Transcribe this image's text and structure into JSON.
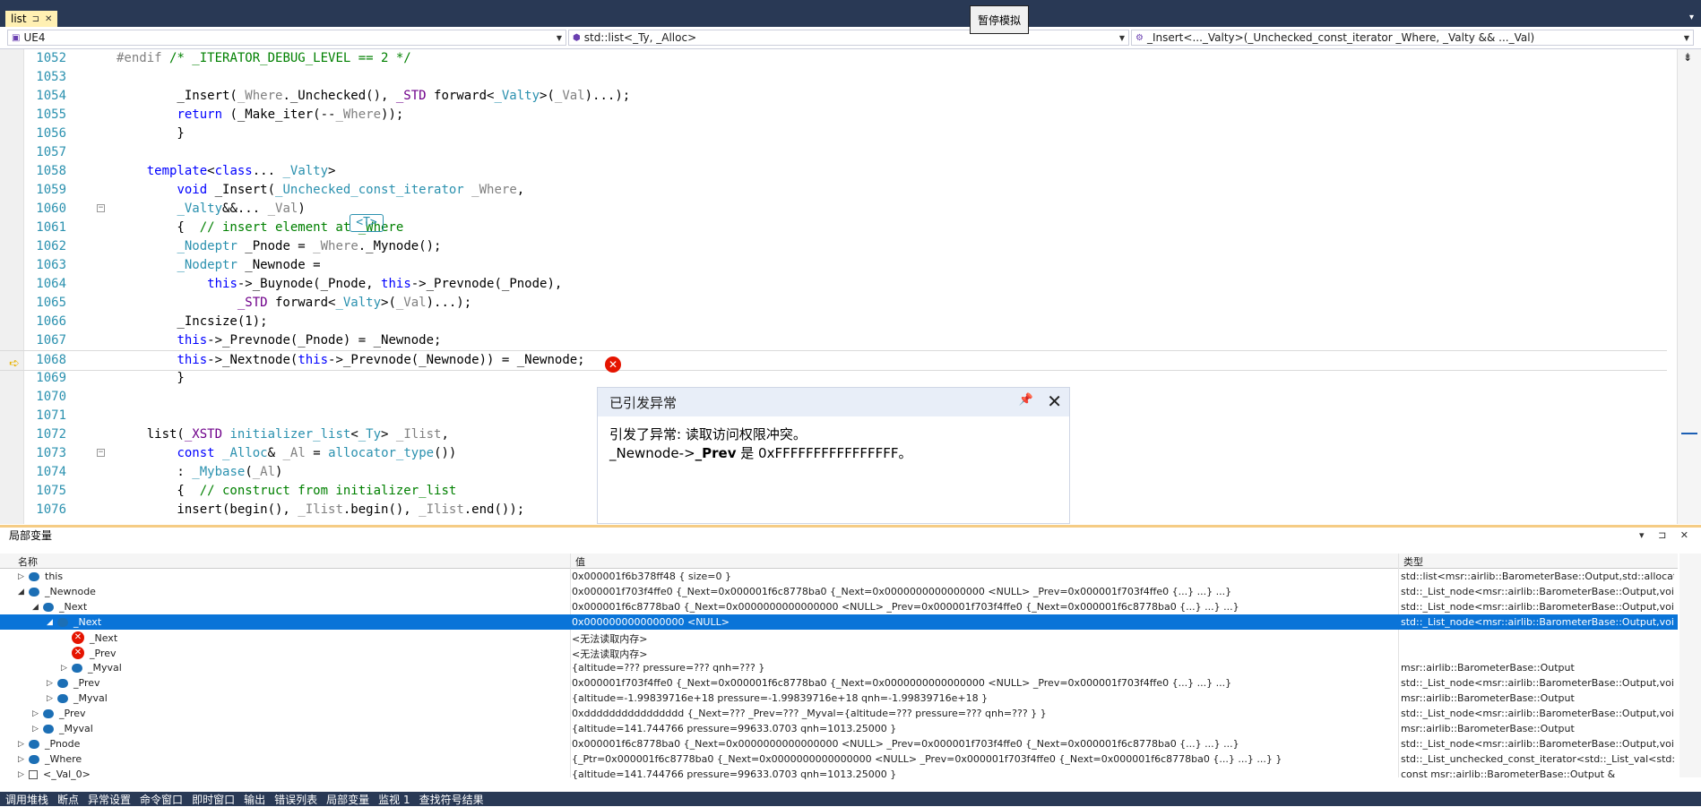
{
  "doc_tab": {
    "label": "list",
    "pin_icon": "pin-icon",
    "close": "✕"
  },
  "pause_badge": "暂停模拟",
  "navbar": {
    "project": "UE4",
    "scope": "std::list<_Ty, _Alloc>",
    "member": "_Insert<..._Valty>(_Unchecked_const_iterator _Where, _Valty && ..._Val)"
  },
  "code_lines": [
    {
      "n": "1052",
      "segs": [
        {
          "t": "#endif ",
          "c": "pr"
        },
        {
          "t": "/* _ITERATOR_DEBUG_LEVEL == 2 */",
          "c": "cm"
        }
      ]
    },
    {
      "n": "1053",
      "segs": []
    },
    {
      "n": "1054",
      "segs": [
        {
          "t": "        _Insert(",
          "c": ""
        },
        {
          "t": "_Where",
          "c": "pr"
        },
        {
          "t": "._Unchecked(), ",
          "c": ""
        },
        {
          "t": "_STD",
          "c": "mc"
        },
        {
          "t": " forward<",
          "c": ""
        },
        {
          "t": "_Valty",
          "c": "ty"
        },
        {
          "t": ">(",
          "c": ""
        },
        {
          "t": "_Val",
          "c": "pr"
        },
        {
          "t": ")...);",
          "c": ""
        }
      ]
    },
    {
      "n": "1055",
      "segs": [
        {
          "t": "        ",
          "c": ""
        },
        {
          "t": "return",
          "c": "kw"
        },
        {
          "t": " (_Make_iter(--",
          "c": ""
        },
        {
          "t": "_Where",
          "c": "pr"
        },
        {
          "t": "));",
          "c": ""
        }
      ]
    },
    {
      "n": "1056",
      "segs": [
        {
          "t": "        }",
          "c": ""
        }
      ]
    },
    {
      "n": "1057",
      "segs": []
    },
    {
      "n": "1058",
      "segs": [
        {
          "t": "    ",
          "c": ""
        },
        {
          "t": "template",
          "c": "kw"
        },
        {
          "t": "<",
          "c": ""
        },
        {
          "t": "class",
          "c": "kw"
        },
        {
          "t": "... ",
          "c": ""
        },
        {
          "t": "_Valty",
          "c": "ty"
        },
        {
          "t": ">",
          "c": ""
        }
      ]
    },
    {
      "n": "1059",
      "segs": [
        {
          "t": "        ",
          "c": ""
        },
        {
          "t": "void",
          "c": "kw"
        },
        {
          "t": " _Insert(",
          "c": ""
        },
        {
          "t": "_Unchecked_const_iterator",
          "c": "ty"
        },
        {
          "t": " ",
          "c": ""
        },
        {
          "t": "_Where",
          "c": "pr"
        },
        {
          "t": ",",
          "c": ""
        }
      ]
    },
    {
      "n": "1060",
      "fold": true,
      "segs": [
        {
          "t": "        ",
          "c": ""
        },
        {
          "t": "_Valty",
          "c": "ty"
        },
        {
          "t": "&&... ",
          "c": ""
        },
        {
          "t": "_Val",
          "c": "pr"
        },
        {
          "t": ")",
          "c": ""
        }
      ]
    },
    {
      "n": "1061",
      "segs": [
        {
          "t": "        {  ",
          "c": ""
        },
        {
          "t": "// insert element at _Where",
          "c": "cm"
        }
      ]
    },
    {
      "n": "1062",
      "segs": [
        {
          "t": "        ",
          "c": ""
        },
        {
          "t": "_Nodeptr",
          "c": "ty"
        },
        {
          "t": " _Pnode = ",
          "c": ""
        },
        {
          "t": "_Where",
          "c": "pr"
        },
        {
          "t": "._Mynode();",
          "c": ""
        }
      ]
    },
    {
      "n": "1063",
      "segs": [
        {
          "t": "        ",
          "c": ""
        },
        {
          "t": "_Nodeptr",
          "c": "ty"
        },
        {
          "t": " _Newnode =",
          "c": ""
        }
      ]
    },
    {
      "n": "1064",
      "segs": [
        {
          "t": "            ",
          "c": ""
        },
        {
          "t": "this",
          "c": "kw"
        },
        {
          "t": "->_Buynode(_Pnode, ",
          "c": ""
        },
        {
          "t": "this",
          "c": "kw"
        },
        {
          "t": "->_Prevnode(_Pnode),",
          "c": ""
        }
      ]
    },
    {
      "n": "1065",
      "segs": [
        {
          "t": "                ",
          "c": ""
        },
        {
          "t": "_STD",
          "c": "mc"
        },
        {
          "t": " forward<",
          "c": ""
        },
        {
          "t": "_Valty",
          "c": "ty"
        },
        {
          "t": ">(",
          "c": ""
        },
        {
          "t": "_Val",
          "c": "pr"
        },
        {
          "t": ")...);",
          "c": ""
        }
      ]
    },
    {
      "n": "1066",
      "segs": [
        {
          "t": "        _Incsize(1);",
          "c": ""
        }
      ]
    },
    {
      "n": "1067",
      "segs": [
        {
          "t": "        ",
          "c": ""
        },
        {
          "t": "this",
          "c": "kw"
        },
        {
          "t": "->_Prevnode(_Pnode) = _Newnode;",
          "c": ""
        }
      ]
    },
    {
      "n": "1068",
      "current": true,
      "segs": [
        {
          "t": "        ",
          "c": ""
        },
        {
          "t": "this",
          "c": "kw"
        },
        {
          "t": "->_Nextnode(",
          "c": ""
        },
        {
          "t": "this",
          "c": "kw"
        },
        {
          "t": "->_Prevnode(_Newnode)) = _Newnode;",
          "c": ""
        }
      ]
    },
    {
      "n": "1069",
      "segs": [
        {
          "t": "        }",
          "c": ""
        }
      ]
    },
    {
      "n": "1070",
      "segs": []
    },
    {
      "n": "1071",
      "segs": []
    },
    {
      "n": "1072",
      "segs": [
        {
          "t": "    list(",
          "c": ""
        },
        {
          "t": "_XSTD",
          "c": "mc"
        },
        {
          "t": " ",
          "c": ""
        },
        {
          "t": "initializer_list",
          "c": "ty"
        },
        {
          "t": "<",
          "c": ""
        },
        {
          "t": "_Ty",
          "c": "ty"
        },
        {
          "t": "> ",
          "c": ""
        },
        {
          "t": "_Ilist",
          "c": "pr"
        },
        {
          "t": ",",
          "c": ""
        }
      ]
    },
    {
      "n": "1073",
      "fold": true,
      "segs": [
        {
          "t": "        ",
          "c": ""
        },
        {
          "t": "const",
          "c": "kw"
        },
        {
          "t": " ",
          "c": ""
        },
        {
          "t": "_Alloc",
          "c": "ty"
        },
        {
          "t": "& ",
          "c": ""
        },
        {
          "t": "_Al",
          "c": "pr"
        },
        {
          "t": " = ",
          "c": ""
        },
        {
          "t": "allocator_type",
          "c": "ty"
        },
        {
          "t": "())",
          "c": ""
        }
      ]
    },
    {
      "n": "1074",
      "segs": [
        {
          "t": "        : ",
          "c": ""
        },
        {
          "t": "_Mybase",
          "c": "ty"
        },
        {
          "t": "(",
          "c": ""
        },
        {
          "t": "_Al",
          "c": "pr"
        },
        {
          "t": ")",
          "c": ""
        }
      ]
    },
    {
      "n": "1075",
      "segs": [
        {
          "t": "        {  ",
          "c": ""
        },
        {
          "t": "// construct from initializer_list",
          "c": "cm"
        }
      ]
    },
    {
      "n": "1076",
      "segs": [
        {
          "t": "        insert(begin(), ",
          "c": ""
        },
        {
          "t": "_Ilist",
          "c": "pr"
        },
        {
          "t": ".begin(), ",
          "c": ""
        },
        {
          "t": "_Ilist",
          "c": "pr"
        },
        {
          "t": ".end());",
          "c": ""
        }
      ]
    }
  ],
  "template_badge": "<T>",
  "exception": {
    "title": "已引发异常",
    "line1": "引发了异常: 读取访问权限冲突。",
    "line2_pre": "_Newnode->",
    "line2_bold": "_Prev",
    "line2_post": " 是 0xFFFFFFFFFFFFFFFF。"
  },
  "locals": {
    "title": "局部变量",
    "columns": {
      "name": "名称",
      "value": "值",
      "type": "类型"
    },
    "rows": [
      {
        "indent": 0,
        "exp": "▷",
        "icon": "obj",
        "name": "this",
        "value": "0x000001f6b378ff48 { size=0 }",
        "type": "std::list<msr::airlib::BarometerBase::Output,std::allocato..."
      },
      {
        "indent": 0,
        "exp": "◢",
        "icon": "obj",
        "name": "_Newnode",
        "value": "0x000001f703f4ffe0 {_Next=0x000001f6c8778ba0 {_Next=0x0000000000000000 <NULL> _Prev=0x000001f703f4ffe0 {...} ...} ...}",
        "type": "std::_List_node<msr::airlib::BarometerBase::Output,void ..."
      },
      {
        "indent": 1,
        "exp": "◢",
        "icon": "obj",
        "name": "_Next",
        "value": "0x000001f6c8778ba0 {_Next=0x0000000000000000 <NULL> _Prev=0x000001f703f4ffe0 {_Next=0x000001f6c8778ba0 {...} ...} ...}",
        "type": "std::_List_node<msr::airlib::BarometerBase::Output,void ..."
      },
      {
        "indent": 2,
        "exp": "◢",
        "icon": "obj",
        "name": "_Next",
        "value": "0x0000000000000000 <NULL>",
        "type": "std::_List_node<msr::airlib::BarometerBase::Output,void ...",
        "selected": true
      },
      {
        "indent": 3,
        "exp": "",
        "icon": "err",
        "name": "_Next",
        "value": "<无法读取内存>",
        "type": ""
      },
      {
        "indent": 3,
        "exp": "",
        "icon": "err",
        "name": "_Prev",
        "value": "<无法读取内存>",
        "type": ""
      },
      {
        "indent": 3,
        "exp": "▷",
        "icon": "obj",
        "name": "_Myval",
        "value": "{altitude=??? pressure=??? qnh=??? }",
        "type": "msr::airlib::BarometerBase::Output"
      },
      {
        "indent": 2,
        "exp": "▷",
        "icon": "obj",
        "name": "_Prev",
        "value": "0x000001f703f4ffe0 {_Next=0x000001f6c8778ba0 {_Next=0x0000000000000000 <NULL> _Prev=0x000001f703f4ffe0 {...} ...} ...}",
        "type": "std::_List_node<msr::airlib::BarometerBase::Output,void ..."
      },
      {
        "indent": 2,
        "exp": "▷",
        "icon": "obj",
        "name": "_Myval",
        "value": "{altitude=-1.99839716e+18 pressure=-1.99839716e+18 qnh=-1.99839716e+18 }",
        "type": "msr::airlib::BarometerBase::Output"
      },
      {
        "indent": 1,
        "exp": "▷",
        "icon": "obj",
        "name": "_Prev",
        "value": "0xdddddddddddddddd {_Next=??? _Prev=??? _Myval={altitude=??? pressure=??? qnh=??? } }",
        "type": "std::_List_node<msr::airlib::BarometerBase::Output,void ..."
      },
      {
        "indent": 1,
        "exp": "▷",
        "icon": "obj",
        "name": "_Myval",
        "value": "{altitude=141.744766 pressure=99633.0703 qnh=1013.25000 }",
        "type": "msr::airlib::BarometerBase::Output"
      },
      {
        "indent": 0,
        "exp": "▷",
        "icon": "obj",
        "name": "_Pnode",
        "value": "0x000001f6c8778ba0 {_Next=0x0000000000000000 <NULL> _Prev=0x000001f703f4ffe0 {_Next=0x000001f6c8778ba0 {...} ...} ...}",
        "type": "std::_List_node<msr::airlib::BarometerBase::Output,void ..."
      },
      {
        "indent": 0,
        "exp": "▷",
        "icon": "obj",
        "name": "_Where",
        "value": "{_Ptr=0x000001f6c8778ba0 {_Next=0x0000000000000000 <NULL> _Prev=0x000001f703f4ffe0 {_Next=0x000001f6c8778ba0 {...} ...} ...} }",
        "type": "std::_List_unchecked_const_iterator<std::_List_val<std::_..."
      },
      {
        "indent": 0,
        "exp": "▷",
        "icon": "list",
        "name": "<_Val_0>",
        "value": "{altitude=141.744766 pressure=99633.0703 qnh=1013.25000 }",
        "type": "const msr::airlib::BarometerBase::Output &"
      }
    ]
  },
  "bottom_tabs": [
    "调用堆栈",
    "断点",
    "异常设置",
    "命令窗口",
    "即时窗口",
    "输出",
    "错误列表",
    "局部变量",
    "监视 1",
    "查找符号结果"
  ]
}
